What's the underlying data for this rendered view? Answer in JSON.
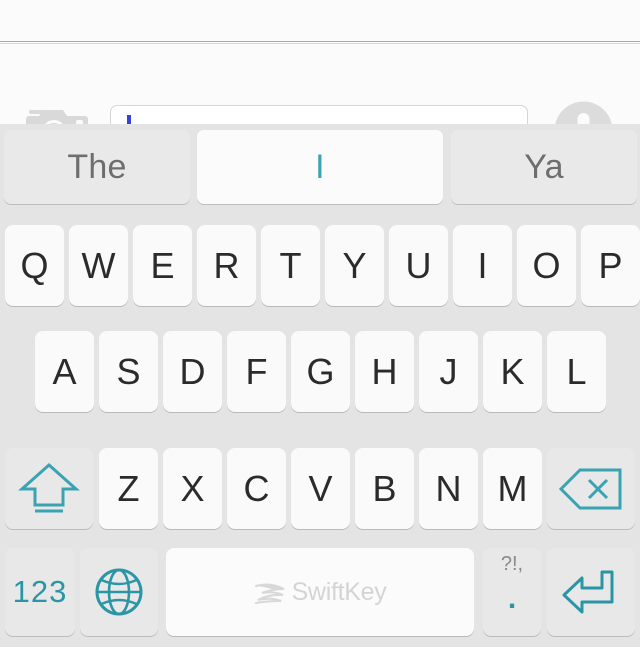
{
  "app": {
    "name": "SwiftKey Keyboard",
    "brand_label": "SwiftKey"
  },
  "colors": {
    "accent_teal": "#2a96a5",
    "caret_blue": "#3b40d6",
    "keyboard_bg": "#e4e4e4",
    "key_bg": "#fafafa",
    "fn_key_bg": "#e8e8e8",
    "letter_text": "#2b2b2b",
    "suggestion_text": "#6e6e6e"
  },
  "input_bar": {
    "camera_icon": "camera-icon",
    "mic_icon": "microphone-icon",
    "text_value": "",
    "placeholder": "",
    "caret_visible": true
  },
  "prediction_bar": {
    "suggestions": [
      {
        "label": "The",
        "selected": false
      },
      {
        "label": "I",
        "selected": true
      },
      {
        "label": "Ya",
        "selected": false
      }
    ]
  },
  "keyboard": {
    "rows": [
      {
        "name": "row-1",
        "keys": [
          "Q",
          "W",
          "E",
          "R",
          "T",
          "Y",
          "U",
          "I",
          "O",
          "P"
        ]
      },
      {
        "name": "row-2",
        "keys": [
          "A",
          "S",
          "D",
          "F",
          "G",
          "H",
          "J",
          "K",
          "L"
        ]
      },
      {
        "name": "row-3",
        "keys": [
          "Z",
          "X",
          "C",
          "V",
          "B",
          "N",
          "M"
        ]
      }
    ],
    "shift_key": {
      "icon": "shift-arrow-icon",
      "label": ""
    },
    "backspace_key": {
      "icon": "backspace-delete-icon",
      "label": ""
    },
    "numeric_key": {
      "label": "123",
      "icon": "numeric-mode-icon"
    },
    "globe_key": {
      "icon": "globe-language-icon",
      "label": ""
    },
    "space_key": {
      "label": "SwiftKey",
      "icon": "swiftkey-logo-icon"
    },
    "punctuation_key": {
      "top_label": "?!,",
      "bottom_label": "."
    },
    "enter_key": {
      "icon": "enter-return-icon",
      "label": ""
    }
  }
}
